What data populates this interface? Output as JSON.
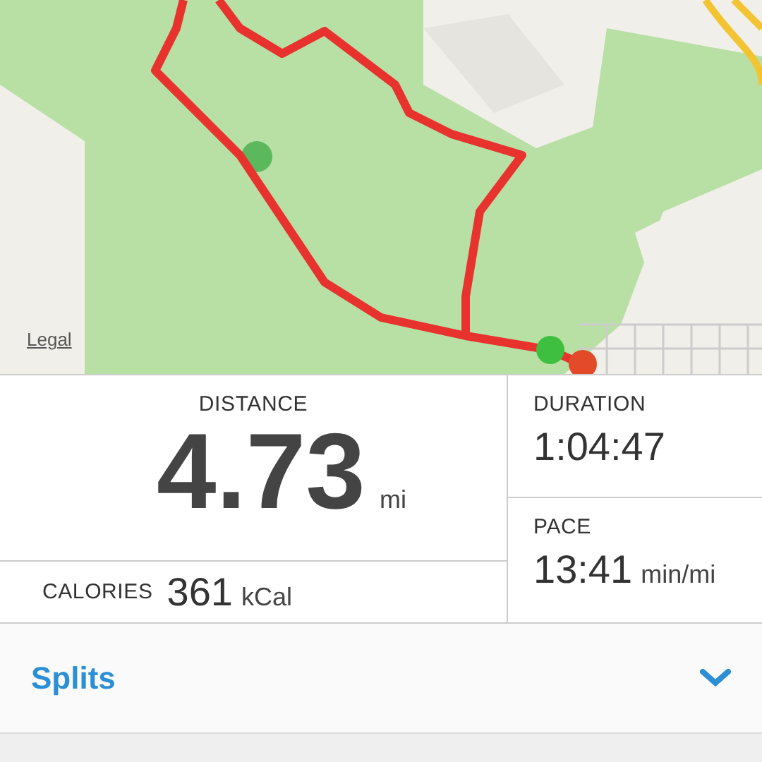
{
  "map": {
    "kind": "picture",
    "legal_link": "Legal"
  },
  "distance": {
    "label": "DISTANCE",
    "value": "4.73",
    "unit": "mi"
  },
  "calories": {
    "label": "CALORIES",
    "value": "361",
    "unit": "kCal"
  },
  "duration": {
    "label": "DURATION",
    "value": "1:04:47"
  },
  "pace": {
    "label": "PACE",
    "value": "13:41",
    "unit": "min/mi"
  },
  "splits": {
    "label": "Splits",
    "expanded": false
  }
}
